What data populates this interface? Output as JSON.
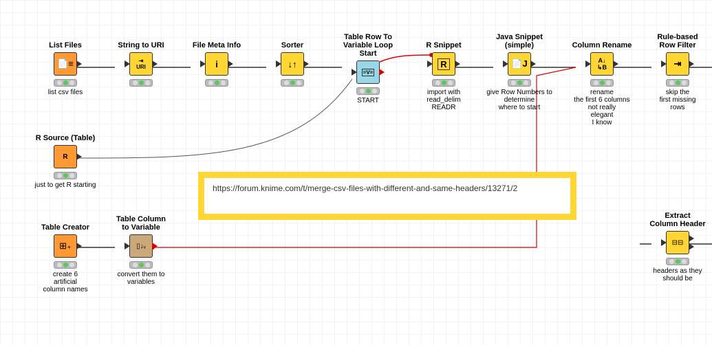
{
  "nodes": {
    "list_files": {
      "title": "List Files",
      "caption": "list csv files"
    },
    "string_to_uri": {
      "title": "String to URI",
      "caption": ""
    },
    "file_meta": {
      "title": "File Meta Info",
      "caption": ""
    },
    "sorter": {
      "title": "Sorter",
      "caption": ""
    },
    "loop_start": {
      "title": "Table Row To\nVariable Loop Start",
      "caption": "START"
    },
    "r_snippet": {
      "title": "R Snippet",
      "caption": "import with\nread_delim\nREADR"
    },
    "java_snippet": {
      "title": "Java Snippet\n(simple)",
      "caption": "give Row Numbers to\ndetermine\nwhere to start"
    },
    "col_rename": {
      "title": "Column Rename",
      "caption": "rename\nthe first 6 columns\nnot really\nelegant\nI know"
    },
    "row_filter": {
      "title": "Rule-based\nRow Filter",
      "caption": "skip the\nfirst missing\nrows"
    },
    "r_source": {
      "title": "R Source (Table)",
      "caption": "just to get R starting"
    },
    "table_creator": {
      "title": "Table Creator",
      "caption": "create 6\nartificial\ncolumn names"
    },
    "col_to_var": {
      "title": "Table Column\nto Variable",
      "caption": "convert them to\nvariables"
    },
    "extract_hdr": {
      "title": "Extract\nColumn Header",
      "caption": "headers as they\nshould be"
    }
  },
  "annotation": {
    "text": "https://forum.knime.com/t/merge-csv-files-with-different-and-same-headers/13271/2"
  },
  "chart_data": {
    "type": "diagram",
    "tool": "KNIME workflow",
    "nodes": [
      {
        "id": "list_files",
        "label": "List Files",
        "caption": "list csv files",
        "type": "source",
        "color": "orange"
      },
      {
        "id": "string_to_uri",
        "label": "String to URI",
        "color": "yellow"
      },
      {
        "id": "file_meta",
        "label": "File Meta Info",
        "color": "yellow"
      },
      {
        "id": "sorter",
        "label": "Sorter",
        "color": "yellow"
      },
      {
        "id": "loop_start",
        "label": "Table Row To Variable Loop Start",
        "caption": "START",
        "color": "blue"
      },
      {
        "id": "r_snippet",
        "label": "R Snippet",
        "caption": "import with read_delim READR",
        "color": "yellow"
      },
      {
        "id": "java_snippet",
        "label": "Java Snippet (simple)",
        "caption": "give Row Numbers to determine where to start",
        "color": "yellow"
      },
      {
        "id": "col_rename",
        "label": "Column Rename",
        "caption": "rename the first 6 columns not really elegant I know",
        "color": "yellow"
      },
      {
        "id": "row_filter",
        "label": "Rule-based Row Filter",
        "caption": "skip the first missing rows",
        "color": "yellow"
      },
      {
        "id": "r_source",
        "label": "R Source (Table)",
        "caption": "just to get R starting",
        "type": "source",
        "color": "orange"
      },
      {
        "id": "table_creator",
        "label": "Table Creator",
        "caption": "create 6 artificial column names",
        "type": "source",
        "color": "orange"
      },
      {
        "id": "col_to_var",
        "label": "Table Column to Variable",
        "caption": "convert them to variables",
        "color": "brown"
      },
      {
        "id": "extract_hdr",
        "label": "Extract Column Header",
        "caption": "headers as they should be",
        "color": "yellow"
      }
    ],
    "edges": [
      {
        "from": "list_files",
        "to": "string_to_uri",
        "kind": "data"
      },
      {
        "from": "string_to_uri",
        "to": "file_meta",
        "kind": "data"
      },
      {
        "from": "file_meta",
        "to": "sorter",
        "kind": "data"
      },
      {
        "from": "sorter",
        "to": "loop_start",
        "kind": "data"
      },
      {
        "from": "loop_start",
        "to": "r_snippet",
        "kind": "flow-variable"
      },
      {
        "from": "r_snippet",
        "to": "java_snippet",
        "kind": "data"
      },
      {
        "from": "java_snippet",
        "to": "col_rename",
        "kind": "data"
      },
      {
        "from": "col_rename",
        "to": "row_filter",
        "kind": "data"
      },
      {
        "from": "row_filter",
        "to": "extract_hdr",
        "kind": "data"
      },
      {
        "from": "r_source",
        "to": "loop_start",
        "kind": "data"
      },
      {
        "from": "table_creator",
        "to": "col_to_var",
        "kind": "data"
      },
      {
        "from": "col_to_var",
        "to": "col_rename",
        "kind": "flow-variable"
      }
    ],
    "annotation": "https://forum.knime.com/t/merge-csv-files-with-different-and-same-headers/13271/2"
  }
}
